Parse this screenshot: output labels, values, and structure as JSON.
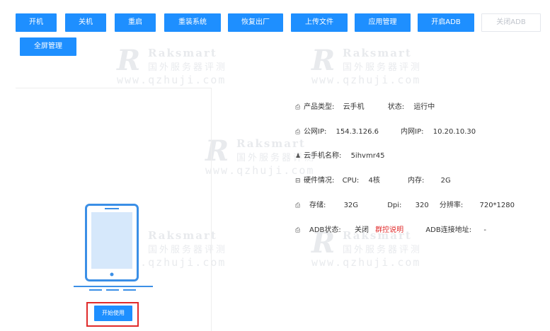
{
  "toolbar": {
    "power_on": "开机",
    "power_off": "关机",
    "restart": "重启",
    "reinstall": "重装系统",
    "factory_reset": "恢复出厂",
    "upload": "上传文件",
    "app_manage": "应用管理",
    "enable_adb": "开启ADB",
    "disable_adb": "关闭ADB",
    "fullscreen": "全屏管理"
  },
  "device": {
    "start_label": "开始使用"
  },
  "info": {
    "product_type_label": "产品类型:",
    "product_type_value": "云手机",
    "status_label": "状态:",
    "status_value": "运行中",
    "public_ip_label": "公网IP:",
    "public_ip_value": "154.3.126.6",
    "private_ip_label": "内网IP:",
    "private_ip_value": "10.20.10.30",
    "name_label": "云手机名称:",
    "name_value": "5ihvmr45",
    "hardware_label": "硬件情况:",
    "cpu_label": "CPU:",
    "cpu_value": "4核",
    "memory_label": "内存:",
    "memory_value": "2G",
    "storage_label": "存储:",
    "storage_value": "32G",
    "dpi_label": "Dpi:",
    "dpi_value": "320",
    "resolution_label": "分辨率:",
    "resolution_value": "720*1280",
    "adb_status_label": "ADB状态:",
    "adb_status_value": "关闭",
    "group_control_link": "群控说明",
    "adb_address_label": "ADB连接地址:",
    "adb_address_value": "-"
  },
  "watermark": {
    "brand": "Raksmart",
    "cn": "国外服务器评测",
    "url": "www.qzhuji.com"
  },
  "colors": {
    "primary": "#1e8fff",
    "danger": "#e02b2b",
    "disabled_text": "#c0c4cc"
  }
}
